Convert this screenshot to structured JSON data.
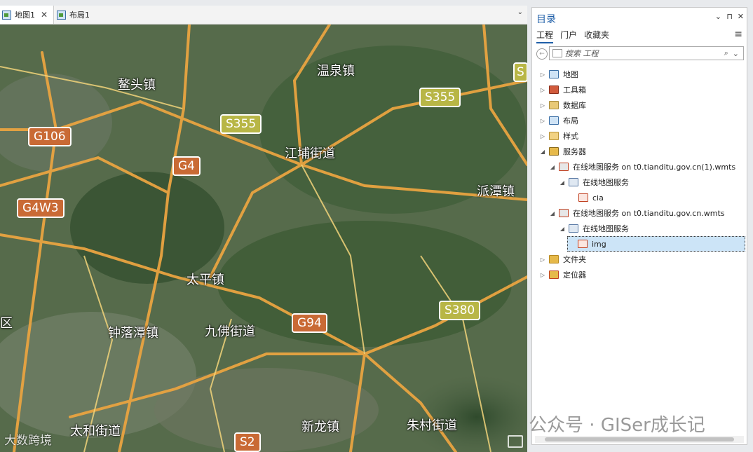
{
  "map_view": {
    "tabs": [
      {
        "label": "地图1",
        "close": "✕"
      },
      {
        "label": "布局1"
      }
    ],
    "dropdown": "⌄",
    "places": [
      "鳌头镇",
      "温泉镇",
      "江埔街道",
      "派潭镇",
      "太平镇",
      "钟落潭镇",
      "九佛街道",
      "新龙镇",
      "朱村街道",
      "太和街道",
      "区"
    ],
    "road_shields": [
      "G106",
      "G4W3",
      "G4",
      "S355",
      "S355",
      "G94",
      "S380",
      "S2",
      "S"
    ],
    "corner_watermark": "大数跨境"
  },
  "catalog": {
    "title": "目录",
    "controls": {
      "dropdown": "⌄",
      "pin": "⊓",
      "close": "✕"
    },
    "tabs": [
      "工程",
      "门户",
      "收藏夹"
    ],
    "active_tab": "工程",
    "menu_icon": "≡",
    "search_placeholder": "搜索 工程",
    "search_icon": "⌕",
    "search_dropdown": "⌄",
    "tree": [
      {
        "label": "地图",
        "icon": "map-folder-icon",
        "expanded": false
      },
      {
        "label": "工具箱",
        "icon": "toolbox-icon",
        "expanded": false
      },
      {
        "label": "数据库",
        "icon": "database-icon",
        "expanded": false
      },
      {
        "label": "布局",
        "icon": "layout-icon",
        "expanded": false
      },
      {
        "label": "样式",
        "icon": "style-icon",
        "expanded": false
      },
      {
        "label": "服务器",
        "icon": "server-icon",
        "expanded": true
      },
      {
        "label": "在线地图服务 on t0.tianditu.gov.cn(1).wmts",
        "icon": "wmts-connection-icon",
        "expanded": true
      },
      {
        "label": "在线地图服务",
        "icon": "map-service-icon",
        "expanded": true
      },
      {
        "label": "cia",
        "icon": "layer-icon"
      },
      {
        "label": "在线地图服务 on t0.tianditu.gov.cn.wmts",
        "icon": "wmts-connection-icon",
        "expanded": true
      },
      {
        "label": "在线地图服务",
        "icon": "map-service-icon",
        "expanded": true
      },
      {
        "label": "img",
        "icon": "layer-icon",
        "selected": true
      },
      {
        "label": "文件夹",
        "icon": "folder-icon",
        "expanded": false
      },
      {
        "label": "定位器",
        "icon": "locator-icon",
        "expanded": false
      }
    ]
  },
  "watermark": "公众号 · GISer成长记"
}
